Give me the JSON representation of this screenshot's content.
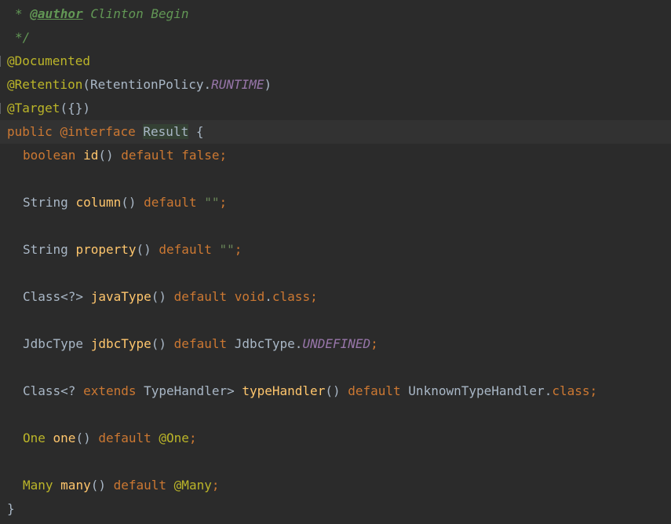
{
  "editor": {
    "colors": {
      "background": "#2b2b2b",
      "current_line": "#323232",
      "comment": "#629755",
      "keyword": "#cc7832",
      "annotation": "#bbb529",
      "method": "#ffc66d",
      "constant": "#9876aa",
      "string": "#6a8759",
      "plain": "#a9b7c6"
    },
    "lines": [
      {
        "indent": 1,
        "tokens": [
          {
            "text": "* ",
            "type": "comment"
          },
          {
            "text": "@author",
            "type": "doctag"
          },
          {
            "text": " Clinton Begin",
            "type": "comment"
          }
        ]
      },
      {
        "indent": 1,
        "tokens": [
          {
            "text": "*/",
            "type": "comment"
          }
        ]
      },
      {
        "indent": 0,
        "fold": true,
        "tokens": [
          {
            "text": "@Documented",
            "type": "ann"
          }
        ]
      },
      {
        "indent": 0,
        "tokens": [
          {
            "text": "@Retention",
            "type": "ann"
          },
          {
            "text": "(RetentionPolicy.",
            "type": "plain"
          },
          {
            "text": "RUNTIME",
            "type": "const"
          },
          {
            "text": ")",
            "type": "plain"
          }
        ]
      },
      {
        "indent": 0,
        "fold": true,
        "tokens": [
          {
            "text": "@Target",
            "type": "ann"
          },
          {
            "text": "({})",
            "type": "plain"
          }
        ]
      },
      {
        "indent": 0,
        "current": true,
        "tokens": [
          {
            "text": "public ",
            "type": "keyword"
          },
          {
            "text": "@interface ",
            "type": "keyword"
          },
          {
            "text": "Result",
            "type": "hl"
          },
          {
            "text": " {",
            "type": "plain"
          }
        ]
      },
      {
        "indent": 2,
        "tokens": [
          {
            "text": "boolean ",
            "type": "keyword"
          },
          {
            "text": "id",
            "type": "method"
          },
          {
            "text": "() ",
            "type": "plain"
          },
          {
            "text": "default false;",
            "type": "keyword"
          }
        ]
      },
      {
        "indent": 0,
        "tokens": []
      },
      {
        "indent": 2,
        "tokens": [
          {
            "text": "String ",
            "type": "plain"
          },
          {
            "text": "column",
            "type": "method"
          },
          {
            "text": "() ",
            "type": "plain"
          },
          {
            "text": "default ",
            "type": "keyword"
          },
          {
            "text": "\"\"",
            "type": "string"
          },
          {
            "text": ";",
            "type": "keyword"
          }
        ]
      },
      {
        "indent": 0,
        "tokens": []
      },
      {
        "indent": 2,
        "tokens": [
          {
            "text": "String ",
            "type": "plain"
          },
          {
            "text": "property",
            "type": "method"
          },
          {
            "text": "() ",
            "type": "plain"
          },
          {
            "text": "default ",
            "type": "keyword"
          },
          {
            "text": "\"\"",
            "type": "string"
          },
          {
            "text": ";",
            "type": "keyword"
          }
        ]
      },
      {
        "indent": 0,
        "tokens": []
      },
      {
        "indent": 2,
        "tokens": [
          {
            "text": "Class<?> ",
            "type": "plain"
          },
          {
            "text": "javaType",
            "type": "method"
          },
          {
            "text": "() ",
            "type": "plain"
          },
          {
            "text": "default void",
            "type": "keyword"
          },
          {
            "text": ".",
            "type": "plain"
          },
          {
            "text": "class;",
            "type": "keyword"
          }
        ]
      },
      {
        "indent": 0,
        "tokens": []
      },
      {
        "indent": 2,
        "tokens": [
          {
            "text": "JdbcType ",
            "type": "plain"
          },
          {
            "text": "jdbcType",
            "type": "method"
          },
          {
            "text": "() ",
            "type": "plain"
          },
          {
            "text": "default ",
            "type": "keyword"
          },
          {
            "text": "JdbcType.",
            "type": "plain"
          },
          {
            "text": "UNDEFINED",
            "type": "const"
          },
          {
            "text": ";",
            "type": "keyword"
          }
        ]
      },
      {
        "indent": 0,
        "tokens": []
      },
      {
        "indent": 2,
        "tokens": [
          {
            "text": "Class<? ",
            "type": "plain"
          },
          {
            "text": "extends ",
            "type": "keyword"
          },
          {
            "text": "TypeHandler> ",
            "type": "plain"
          },
          {
            "text": "typeHandler",
            "type": "method"
          },
          {
            "text": "() ",
            "type": "plain"
          },
          {
            "text": "default ",
            "type": "keyword"
          },
          {
            "text": "UnknownTypeHandler.",
            "type": "plain"
          },
          {
            "text": "class;",
            "type": "keyword"
          }
        ]
      },
      {
        "indent": 0,
        "tokens": []
      },
      {
        "indent": 2,
        "tokens": [
          {
            "text": "One ",
            "type": "ann"
          },
          {
            "text": "one",
            "type": "method"
          },
          {
            "text": "() ",
            "type": "plain"
          },
          {
            "text": "default ",
            "type": "keyword"
          },
          {
            "text": "@One",
            "type": "ann"
          },
          {
            "text": ";",
            "type": "keyword"
          }
        ]
      },
      {
        "indent": 0,
        "tokens": []
      },
      {
        "indent": 2,
        "tokens": [
          {
            "text": "Many ",
            "type": "ann"
          },
          {
            "text": "many",
            "type": "method"
          },
          {
            "text": "() ",
            "type": "plain"
          },
          {
            "text": "default ",
            "type": "keyword"
          },
          {
            "text": "@Many",
            "type": "ann"
          },
          {
            "text": ";",
            "type": "keyword"
          }
        ]
      },
      {
        "indent": 0,
        "tokens": [
          {
            "text": "}",
            "type": "plain"
          }
        ]
      }
    ]
  }
}
